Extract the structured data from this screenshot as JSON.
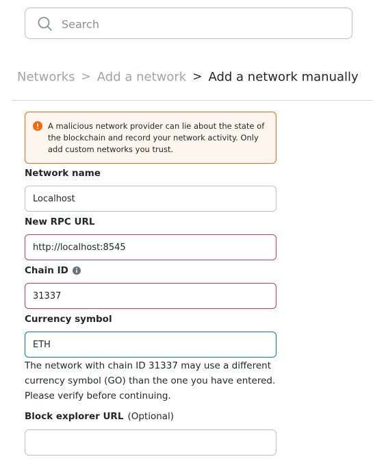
{
  "search": {
    "placeholder": "Search",
    "value": ""
  },
  "breadcrumb": {
    "items": [
      "Networks",
      "Add a network"
    ],
    "separator": ">",
    "current": "Add a network manually"
  },
  "warning": {
    "icon": "exclamation-circle-icon",
    "color": "#f66a0a",
    "text": "A malicious network provider can lie about the state of the blockchain and record your network activity. Only add custom networks you trust."
  },
  "form": {
    "network_name": {
      "label": "Network name",
      "value": "Localhost"
    },
    "rpc_url": {
      "label": "New RPC URL",
      "value": "http://localhost:8545"
    },
    "chain_id": {
      "label": "Chain ID",
      "value": "31337",
      "info_icon": "info-icon"
    },
    "currency_symbol": {
      "label": "Currency symbol",
      "value": "ETH",
      "helper": "The network with chain ID 31337 may use a different currency symbol (GO) than the one you have entered. Please verify before continuing."
    },
    "block_explorer": {
      "label": "Block explorer URL",
      "optional": "(Optional)",
      "value": ""
    }
  },
  "colors": {
    "error": "#d73a49",
    "focus": "#0376c9",
    "muted": "#9fa6ae"
  }
}
